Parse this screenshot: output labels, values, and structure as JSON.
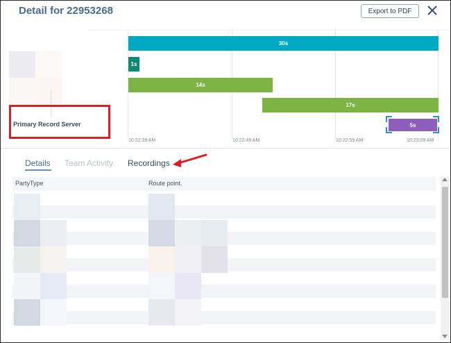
{
  "header": {
    "title": "Detail for 22953268",
    "export_label": "Export to PDF",
    "close_icon": "close-icon"
  },
  "left_panel": {
    "server_label": "Primary Record Server",
    "highlight_color": "#e11b22"
  },
  "timeline": {
    "bars": [
      {
        "label": "30s",
        "color": "#00a9c2"
      },
      {
        "label": "1s",
        "color": "#0f8a72"
      },
      {
        "label": "14s",
        "color": "#7cb342"
      },
      {
        "label": "17s",
        "color": "#7cb342"
      },
      {
        "label": "5s",
        "color": "#8e5ebd"
      }
    ],
    "ticks": [
      "10:22:39 AM",
      "10:22:49 AM",
      "10:22:59 AM",
      "10:23:09 AM"
    ]
  },
  "tabs": [
    {
      "label": "Details",
      "active": true
    },
    {
      "label": "Team Activity",
      "active": false
    },
    {
      "label": "Recordings",
      "active": false
    }
  ],
  "table": {
    "columns": [
      "PartyType",
      "Route point."
    ]
  },
  "annotation": {
    "arrow_color": "#e11b22"
  }
}
